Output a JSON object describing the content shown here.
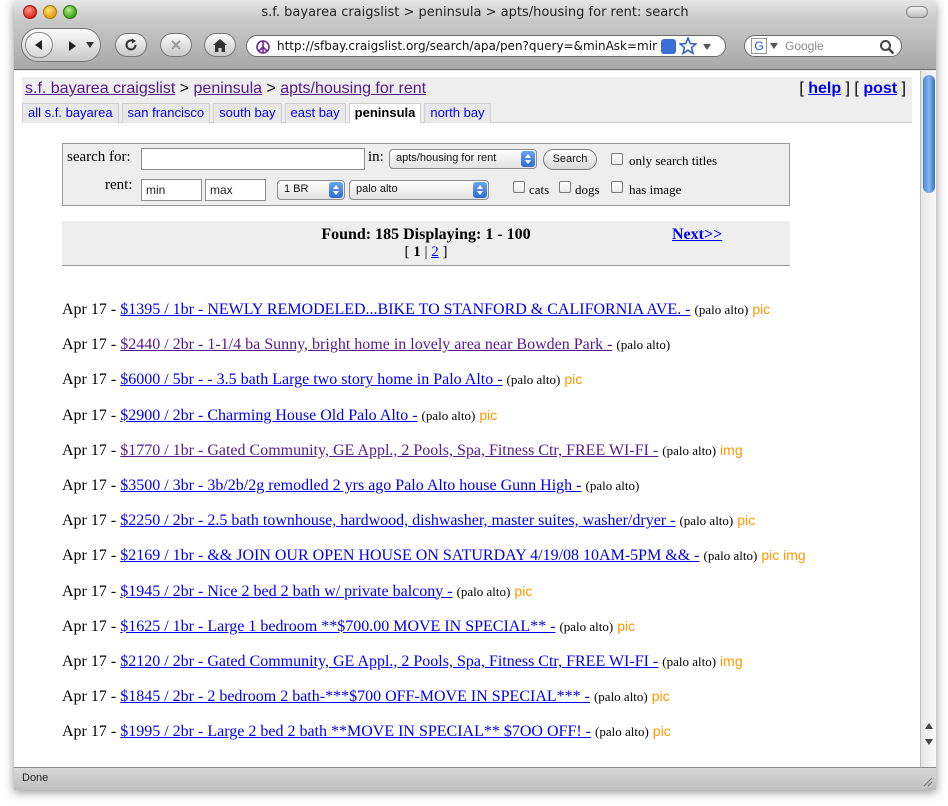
{
  "window": {
    "title": "s.f. bayarea craigslist > peninsula > apts/housing for rent: search"
  },
  "toolbar": {
    "url": "http://sfbay.craigslist.org/search/apa/pen?query=&minAsk=min",
    "search_placeholder": "Google"
  },
  "status": {
    "text": "Done"
  },
  "header": {
    "crumb_site": "s.f. bayarea craigslist",
    "crumb_sep1": " > ",
    "crumb_area": "peninsula",
    "crumb_sep2": " > ",
    "crumb_category": "apts/housing for rent",
    "bracket_open_1": "[ ",
    "help_label": "help",
    "bracket_mid": " ] [ ",
    "post_label": "post",
    "bracket_close": " ]"
  },
  "tabs": [
    {
      "label": "all s.f. bayarea"
    },
    {
      "label": "san francisco"
    },
    {
      "label": "south bay"
    },
    {
      "label": "east bay"
    },
    {
      "label": "peninsula"
    },
    {
      "label": "north bay"
    }
  ],
  "search": {
    "search_for_label": "search for:",
    "query_value": "",
    "in_label": "in:",
    "category_value": "apts/housing for rent",
    "search_button": "Search",
    "only_titles_label": "only search titles",
    "rent_label": "rent:",
    "min_placeholder": "min",
    "max_placeholder": "max",
    "bedrooms_value": "1 BR",
    "neighborhood_value": "palo alto",
    "cats_label": "cats",
    "dogs_label": "dogs",
    "has_image_label": "has image"
  },
  "results": {
    "found_text": "Found: 185 Displaying: 1 - 100",
    "page_open": "[ ",
    "current_page": "1",
    "page_sep": " | ",
    "page_2": "2",
    "page_close": " ]",
    "next_label": "Next>>"
  },
  "listings": [
    {
      "date": "Apr 17 - ",
      "title": "$1395 / 1br - NEWLY REMODELED...BIKE TO STANFORD & CALIFORNIA AVE. -",
      "location": "(palo alto)",
      "tags": "pic",
      "visited": false
    },
    {
      "date": "Apr 17 - ",
      "title": "$2440 / 2br - 1-1/4 ba Sunny, bright home in lovely area near Bowden Park -",
      "location": "(palo alto)",
      "tags": "",
      "visited": true
    },
    {
      "date": "Apr 17 - ",
      "title": "$6000 / 5br - - 3.5 bath Large two story home in Palo Alto -",
      "location": "(palo alto)",
      "tags": "pic",
      "visited": false
    },
    {
      "date": "Apr 17 - ",
      "title": "$2900 / 2br - Charming House Old Palo Alto -",
      "location": "(palo alto)",
      "tags": "pic",
      "visited": false
    },
    {
      "date": "Apr 17 - ",
      "title": "$1770 / 1br - Gated Community, GE Appl., 2 Pools, Spa, Fitness Ctr, FREE WI-FI -",
      "location": "(palo alto)",
      "tags": "img",
      "visited": true
    },
    {
      "date": "Apr 17 - ",
      "title": "$3500 / 3br - 3b/2b/2g remodled 2 yrs ago Palo Alto house Gunn High -",
      "location": "(palo alto)",
      "tags": "",
      "visited": false
    },
    {
      "date": "Apr 17 - ",
      "title": "$2250 / 2br - 2.5 bath townhouse, hardwood, dishwasher, master suites, washer/dryer -",
      "location": "(palo alto)",
      "tags": "pic",
      "visited": false
    },
    {
      "date": "Apr 17 - ",
      "title": "$2169 / 1br - && JOIN OUR OPEN HOUSE ON SATURDAY 4/19/08 10AM-5PM && -",
      "location": "(palo alto)",
      "tags": "pic img",
      "visited": false
    },
    {
      "date": "Apr 17 - ",
      "title": "$1945 / 2br - Nice 2 bed 2 bath w/ private balcony -",
      "location": "(palo alto)",
      "tags": "pic",
      "visited": false
    },
    {
      "date": "Apr 17 - ",
      "title": "$1625 / 1br - Large 1 bedroom **$700.00 MOVE IN SPECIAL** -",
      "location": "(palo alto)",
      "tags": "pic",
      "visited": false
    },
    {
      "date": "Apr 17 - ",
      "title": "$2120 / 2br - Gated Community, GE Appl., 2 Pools, Spa, Fitness Ctr, FREE WI-FI -",
      "location": "(palo alto)",
      "tags": "img",
      "visited": false
    },
    {
      "date": "Apr 17 - ",
      "title": "$1845 / 2br - 2 bedroom 2 bath-***$700 OFF-MOVE IN SPECIAL*** -",
      "location": "(palo alto)",
      "tags": "pic",
      "visited": false
    },
    {
      "date": "Apr 17 - ",
      "title": "$1995 / 2br - Large 2 bed 2 bath **MOVE IN SPECIAL** $7OO OFF! -",
      "location": "(palo alto)",
      "tags": "pic",
      "visited": false
    }
  ],
  "colors": {
    "link": "#0000ee",
    "visited": "#551a8b",
    "pic_tag": "#ff9900",
    "panel": "#eeeeee"
  }
}
